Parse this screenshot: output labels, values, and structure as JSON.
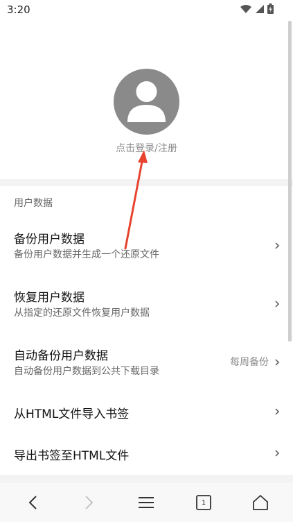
{
  "status_bar": {
    "time": "3:20",
    "icons": [
      "wifi-icon",
      "cellular-signal-icon",
      "battery-charging-icon"
    ]
  },
  "profile": {
    "avatar_icon": "user-silhouette-icon",
    "login_label": "点击登录/注册"
  },
  "section": {
    "header": "用户数据",
    "items": [
      {
        "title": "备份用户数据",
        "subtitle": "备份用户数据并生成一个还原文件",
        "value": ""
      },
      {
        "title": "恢复用户数据",
        "subtitle": "从指定的还原文件恢复用户数据",
        "value": ""
      },
      {
        "title": "自动备份用户数据",
        "subtitle": "自动备份用户数据到公共下载目录",
        "value": "每周备份"
      },
      {
        "title": "从HTML文件导入书签",
        "subtitle": "",
        "value": ""
      },
      {
        "title": "导出书签至HTML文件",
        "subtitle": "",
        "value": ""
      }
    ]
  },
  "nav": {
    "tab_count": "1",
    "icons": [
      "back-icon",
      "forward-icon",
      "menu-icon",
      "tabs-icon",
      "home-icon"
    ]
  },
  "colors": {
    "annotation_arrow": "#e8432f",
    "avatar_bg": "#8a8a8a"
  }
}
